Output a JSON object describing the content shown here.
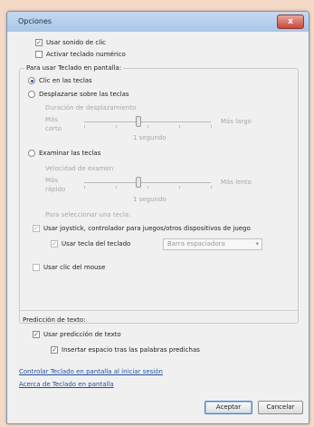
{
  "window": {
    "title": "Opciones",
    "close": "x"
  },
  "options": {
    "use_click_sound": "Usar sonido de clic",
    "activate_numpad": "Activar teclado numérico",
    "use_osk_heading": "Para usar Teclado en pantalla:",
    "click_keys": "Clic en las teclas",
    "hover_keys": "Desplazarse sobre las teclas",
    "hover_duration": "Duración de desplazamiento",
    "faster": "Más",
    "faster_2": "corto",
    "longer": "Más largo",
    "hover_value": "1 segundo",
    "scan_keys": "Examinar las teclas",
    "scan_speed": "Velocidad de examen",
    "fast": "Más",
    "fast_2": "rápido",
    "slow": "Más lento",
    "scan_value": "1 segundo",
    "select_key_label": "Para seleccionar una tecla:",
    "use_joystick": "Usar joystick, controlador para juegos/otros dispositivos de juego",
    "use_keyboard_key": "Usar tecla del teclado",
    "key_select_value": "Barra espaciadora",
    "use_mouse_click": "Usar clic del mouse"
  },
  "prediction": {
    "heading": "Predicción de texto:",
    "use_prediction": "Usar predicción de texto",
    "insert_space": "Insertar espacio tras las palabras predichas"
  },
  "links": {
    "control_at_logon": "Controlar Teclado en pantalla al iniciar sesión",
    "about": "Acerca de Teclado en pantalla"
  },
  "buttons": {
    "accept": "Aceptar",
    "cancel": "Cancelar"
  },
  "checks": {
    "checked": "✓"
  }
}
